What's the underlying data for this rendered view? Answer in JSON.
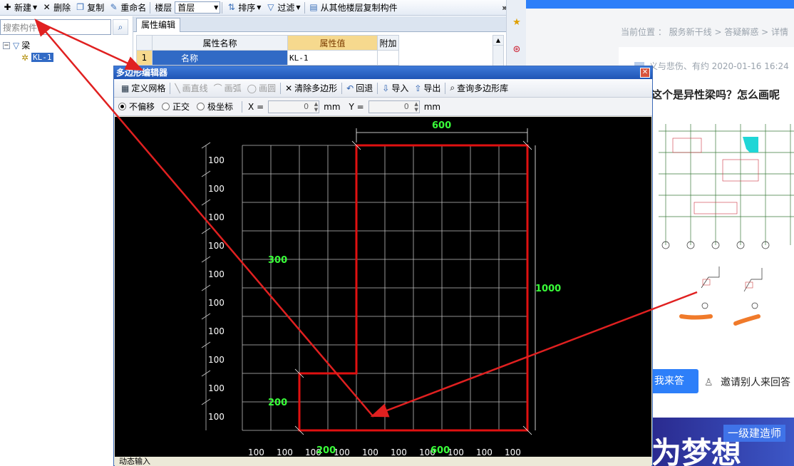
{
  "app": {
    "toolbar": {
      "new_label": "新建",
      "delete_label": "删除",
      "copy_label": "复制",
      "rename_label": "重命名",
      "floor_label": "楼层",
      "floor_value": "首层",
      "sort_label": "排序",
      "filter_label": "过滤",
      "copy_from_floor_label": "从其他楼层复制构件",
      "more_label": "»"
    },
    "search": {
      "placeholder": "搜索构件..."
    },
    "tree": {
      "root_label": "梁",
      "child_label": "KL-1"
    },
    "props": {
      "tab_label": "属性编辑",
      "col_name": "属性名称",
      "col_value": "属性值",
      "col_extra": "附加",
      "rows": [
        {
          "num": "1",
          "name": "名称",
          "value": "KL-1"
        }
      ]
    }
  },
  "web": {
    "breadcrumb": "当前位置 ： 服务新干线 > 答疑解惑 > 详情",
    "meta": "义与悲伤、有约   2020-01-16 16:24",
    "title": "这个是异性梁吗？怎么画呢",
    "answer_label": "我来答",
    "invite_label": "邀请别人来回答",
    "banner_badge": "一级建造师",
    "banner_slogan": "为梦想"
  },
  "dialog": {
    "title": "多边形编辑器",
    "toolbar": {
      "define_grid": "定义网格",
      "draw_line": "画直线",
      "draw_arc": "画弧",
      "draw_circle": "画圆",
      "clear_polygon": "清除多边形",
      "undo": "回退",
      "import": "导入",
      "export": "导出",
      "query_library": "查询多边形库"
    },
    "options": {
      "no_offset": "不偏移",
      "orthogonal": "正交",
      "polar": "极坐标",
      "x_label": "X =",
      "x_value": "0",
      "y_label": "Y =",
      "y_value": "0",
      "unit": "mm"
    },
    "status_label": "动态输入",
    "grid": {
      "row_labels": [
        "100",
        "100",
        "100",
        "100",
        "100",
        "100",
        "100",
        "100",
        "100",
        "100"
      ],
      "col_labels": [
        "100",
        "100",
        "100",
        "100",
        "100",
        "100",
        "100",
        "100",
        "100",
        "100"
      ],
      "dim_top": "600",
      "dim_right": "1000",
      "dim_left_upper": "300",
      "dim_left_lower": "200",
      "dim_bottom_left": "200",
      "dim_bottom_right": "600"
    },
    "colors": {
      "grid": "#bfbfbf",
      "dims": "#39ff39",
      "polygon": "#e01010"
    }
  }
}
